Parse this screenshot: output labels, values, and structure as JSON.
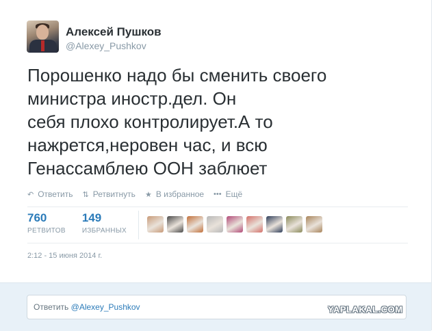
{
  "author": {
    "name": "Алексей Пушков",
    "handle": "@Alexey_Pushkov"
  },
  "tweet": {
    "text": "Порошенко надо бы сменить своего\nминистра иностр.дел. Он\nсебя плохо контролирует.А то\nнажрется,неровен час, и всю\nГенассамблею ООН заблюет"
  },
  "actions": {
    "reply_icon": "reply-arrow-icon",
    "reply": "Ответить",
    "retweet_icon": "retweet-icon",
    "retweet": "Ретвитнуть",
    "favorite_icon": "star-icon",
    "favorite": "В избранное",
    "more_icon": "ellipsis-icon",
    "more": "Ещё"
  },
  "stats": {
    "retweets": "760",
    "retweets_label": "РЕТВИТОВ",
    "favorites": "149",
    "favorites_label": "ИЗБРАННЫХ"
  },
  "favoriters_colors": [
    "#c89a78",
    "#4a4a4a",
    "#c2703a",
    "#b8b8b8",
    "#b24a78",
    "#d4706a",
    "#2f3e5a",
    "#8a8a5a",
    "#a8845a"
  ],
  "date": "2:12 - 15 июня 2014 г.",
  "reply": {
    "prefix": "Ответить",
    "mention": "@Alexey_Pushkov"
  },
  "watermark": "YAPLAKAL.COM",
  "colors": {
    "link": "#2b7bb9",
    "muted": "#8899a6",
    "text": "#292f33",
    "reply_bg": "#e8f1f8"
  }
}
